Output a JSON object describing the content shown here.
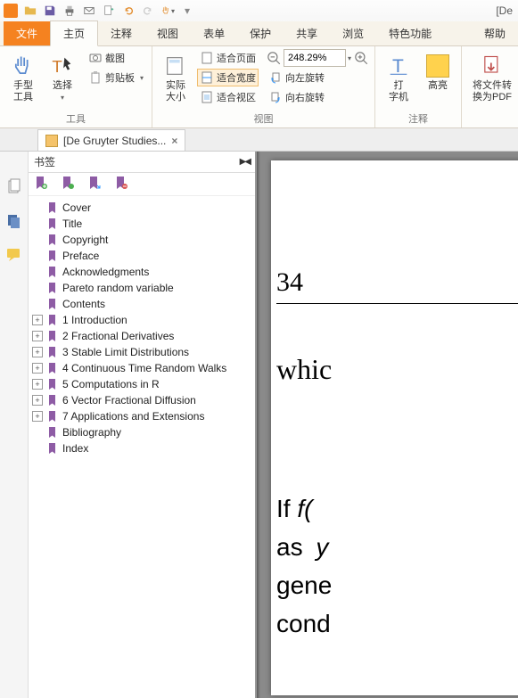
{
  "title_right": "[De",
  "tabs": {
    "file": "文件",
    "home": "主页",
    "comment": "注释",
    "view": "视图",
    "form": "表单",
    "protect": "保护",
    "share": "共享",
    "browse": "浏览",
    "feature": "特色功能",
    "help": "帮助"
  },
  "ribbon": {
    "tools_group": "工具",
    "hand_tool_l1": "手型",
    "hand_tool_l2": "工具",
    "select": "选择",
    "screenshot": "截图",
    "clipboard": "剪贴板",
    "actual_size_l1": "实际",
    "actual_size_l2": "大小",
    "fit_page": "适合页面",
    "fit_width": "适合宽度",
    "fit_visible": "适合视区",
    "view_group": "视图",
    "zoom_value": "248.29%",
    "rotate_left": "向左旋转",
    "rotate_right": "向右旋转",
    "typewriter_l1": "打",
    "typewriter_l2": "字机",
    "highlight": "高亮",
    "annot_group": "注释",
    "convert_l1": "将文件转",
    "convert_l2": "换为PDF"
  },
  "doc_tab": "[De Gruyter Studies...",
  "bookmarks_title": "书签",
  "bookmarks": [
    {
      "label": "Cover",
      "exp": ""
    },
    {
      "label": "Title",
      "exp": ""
    },
    {
      "label": "Copyright",
      "exp": ""
    },
    {
      "label": "Preface",
      "exp": ""
    },
    {
      "label": "Acknowledgments",
      "exp": ""
    },
    {
      "label": "Pareto random variable",
      "exp": ""
    },
    {
      "label": "Contents",
      "exp": ""
    },
    {
      "label": "1 Introduction",
      "exp": "+"
    },
    {
      "label": "2 Fractional Derivatives",
      "exp": "+"
    },
    {
      "label": "3 Stable Limit Distributions",
      "exp": "+"
    },
    {
      "label": "4 Continuous Time Random Walks",
      "exp": "+"
    },
    {
      "label": "5 Computations in R",
      "exp": "+"
    },
    {
      "label": "6 Vector Fractional Diffusion",
      "exp": "+"
    },
    {
      "label": "7 Applications and Extensions",
      "exp": "+"
    },
    {
      "label": "Bibliography",
      "exp": ""
    },
    {
      "label": "Index",
      "exp": ""
    }
  ],
  "page": {
    "number": "34",
    "which": "whic",
    "body_if": "If ",
    "body_fx": "f(",
    "body_as": "as ",
    "body_y": "y",
    "body_gene": "gene",
    "body_cond": "cond"
  }
}
